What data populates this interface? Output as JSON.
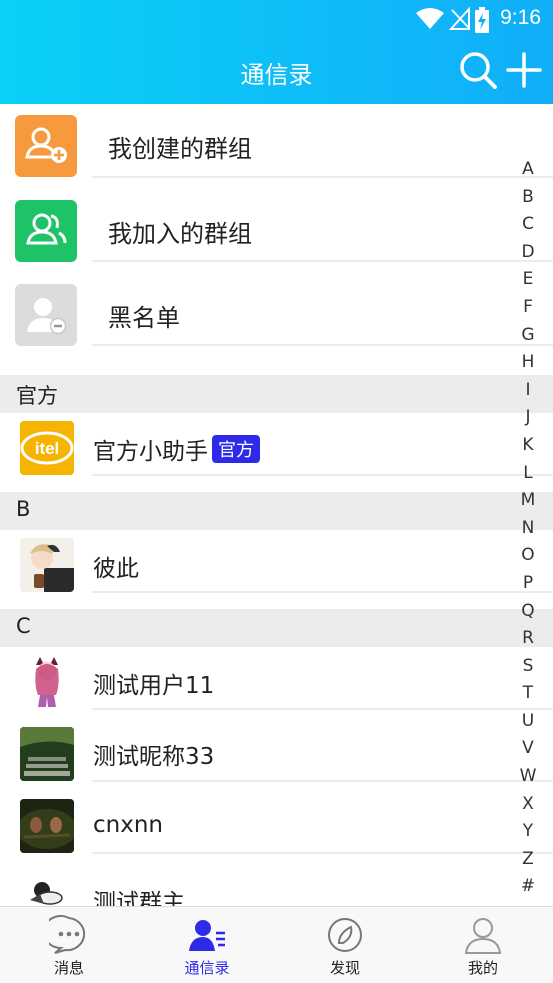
{
  "status_bar": {
    "time": "9:16"
  },
  "header": {
    "title": "通信录"
  },
  "groups": [
    {
      "label": "我创建的群组",
      "icon": "group-add-icon",
      "color": "#f79a3e"
    },
    {
      "label": "我加入的群组",
      "icon": "group-icon",
      "color": "#1ec267"
    },
    {
      "label": "黑名单",
      "icon": "blacklist-icon",
      "color": "#dcdcdc"
    }
  ],
  "sections": [
    {
      "title": "官方",
      "contacts": [
        {
          "name": "官方小助手",
          "badge": "官方",
          "avatar_text": "itel"
        }
      ]
    },
    {
      "title": "B",
      "contacts": [
        {
          "name": "彼此"
        }
      ]
    },
    {
      "title": "C",
      "contacts": [
        {
          "name": "测试用户11"
        },
        {
          "name": "测试昵称33"
        },
        {
          "name": "cnxnn"
        },
        {
          "name": "测试群主"
        }
      ]
    }
  ],
  "index_letters": [
    "A",
    "B",
    "C",
    "D",
    "E",
    "F",
    "G",
    "H",
    "I",
    "J",
    "K",
    "L",
    "M",
    "N",
    "O",
    "P",
    "Q",
    "R",
    "S",
    "T",
    "U",
    "V",
    "W",
    "X",
    "Y",
    "Z",
    "#"
  ],
  "bottom_nav": [
    {
      "label": "消息",
      "icon": "message-icon"
    },
    {
      "label": "通信录",
      "icon": "contacts-icon",
      "active": true
    },
    {
      "label": "发现",
      "icon": "compass-icon"
    },
    {
      "label": "我的",
      "icon": "profile-icon"
    }
  ],
  "colors": {
    "header_start": "#0ad0f7",
    "header_end": "#11aef8",
    "accent": "#2e2be8"
  }
}
